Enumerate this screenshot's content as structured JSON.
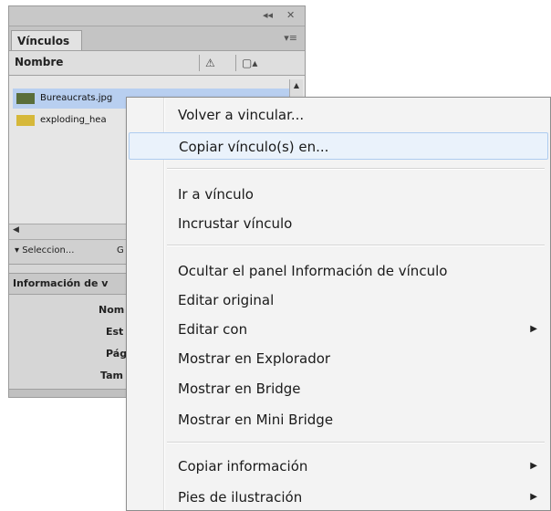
{
  "panel": {
    "top_controls": {
      "collapse": "◂◂",
      "close": "✕"
    },
    "tab_label": "Vínculos",
    "panel_menu_icon": "▾≡",
    "column_header": {
      "name": "Nombre",
      "warning_icon": "⚠",
      "page_icon": "▢▴"
    },
    "links": [
      {
        "filename": "Bureaucrats.jpg",
        "selected": true,
        "thumb_color": "#5a6e3a"
      },
      {
        "filename": "exploding_hea",
        "selected": false,
        "thumb_color": "#d6b83a"
      }
    ],
    "footer": {
      "selection_label": "▾ Seleccion...",
      "g_label": "G"
    },
    "info_title": "Información de v",
    "info_labels": [
      "Nom",
      "Est",
      "Pág",
      "Tam"
    ]
  },
  "context_menu": {
    "items": [
      {
        "label": "Volver a vincular...",
        "submenu": false,
        "hover": false
      },
      {
        "label": "Copiar vínculo(s) en...",
        "submenu": false,
        "hover": true
      },
      {
        "label": "Ir a vínculo",
        "submenu": false,
        "hover": false
      },
      {
        "label": "Incrustar vínculo",
        "submenu": false,
        "hover": false
      },
      {
        "label": "Ocultar el panel Información de vínculo",
        "submenu": false,
        "hover": false
      },
      {
        "label": "Editar original",
        "submenu": false,
        "hover": false
      },
      {
        "label": "Editar con",
        "submenu": true,
        "hover": false
      },
      {
        "label": "Mostrar en Explorador",
        "submenu": false,
        "hover": false
      },
      {
        "label": "Mostrar en Bridge",
        "submenu": false,
        "hover": false
      },
      {
        "label": "Mostrar en Mini Bridge",
        "submenu": false,
        "hover": false
      },
      {
        "label": "Copiar información",
        "submenu": true,
        "hover": false
      },
      {
        "label": "Pies de ilustración",
        "submenu": true,
        "hover": false
      }
    ],
    "submenu_arrow": "▶"
  }
}
